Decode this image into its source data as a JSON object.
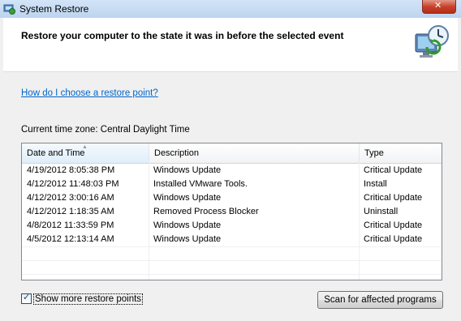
{
  "window": {
    "title": "System Restore",
    "icon": "system-restore-icon"
  },
  "header": {
    "heading": "Restore your computer to the state it was in before the selected event",
    "icon": "system-restore-clock-icon"
  },
  "help_link": "How do I choose a restore point?",
  "timezone_label": "Current time zone: Central Daylight Time",
  "table": {
    "columns": [
      "Date and Time",
      "Description",
      "Type"
    ],
    "sorted_column": "Date and Time",
    "rows": [
      [
        "4/19/2012 8:05:38 PM",
        "Windows Update",
        "Critical Update"
      ],
      [
        "4/12/2012 11:48:03 PM",
        "Installed VMware Tools.",
        "Install"
      ],
      [
        "4/12/2012 3:00:16 AM",
        "Windows Update",
        "Critical Update"
      ],
      [
        "4/12/2012 1:18:35 AM",
        "Removed Process Blocker",
        "Uninstall"
      ],
      [
        "4/8/2012 11:33:59 PM",
        "Windows Update",
        "Critical Update"
      ],
      [
        "4/5/2012 12:13:14 AM",
        "Windows Update",
        "Critical Update"
      ]
    ]
  },
  "show_more_checkbox": {
    "label": "Show more restore points",
    "checked": true
  },
  "scan_button": "Scan for affected programs",
  "colors": {
    "link": "#0066cc",
    "titlebar": "#bcd4ef",
    "close_button": "#c8402a"
  }
}
